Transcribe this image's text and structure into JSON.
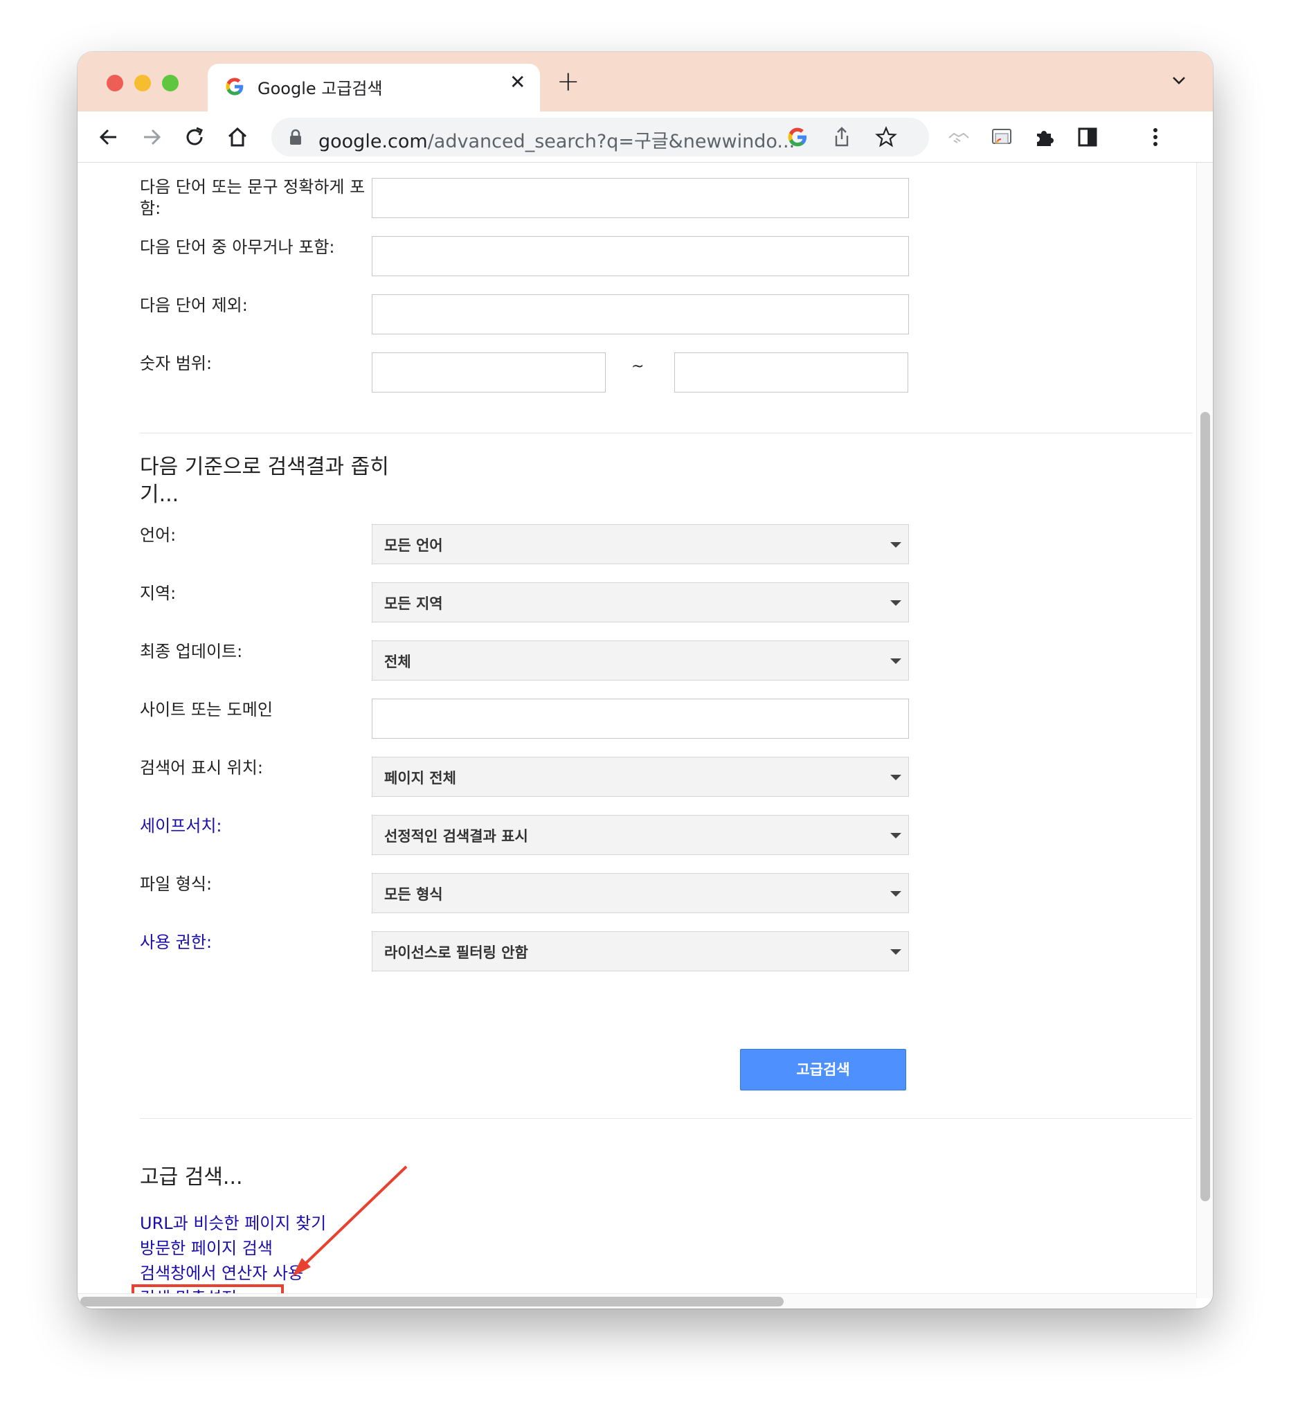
{
  "browser": {
    "tab_title": "Google 고급검색",
    "tab_close": "✕",
    "new_tab": "+",
    "url_host": "google.com",
    "url_path": "/advanced_search?q=구글&newwindo..."
  },
  "form_top": {
    "exact_phrase_label": "다음 단어 또는 문구 정확하게 포함:",
    "any_words_label": "다음 단어 중 아무거나 포함:",
    "exclude_label": "다음 단어 제외:",
    "range_label": "숫자 범위:",
    "range_separator": "~"
  },
  "narrow": {
    "title": "다음 기준으로 검색결과 좁히기...",
    "language_label": "언어:",
    "language_value": "모든 언어",
    "region_label": "지역:",
    "region_value": "모든 지역",
    "updated_label": "최종 업데이트:",
    "updated_value": "전체",
    "site_label": "사이트 또는 도메인",
    "terms_label": "검색어 표시 위치:",
    "terms_value": "페이지 전체",
    "safesearch_label": "세이프서치:",
    "safesearch_value": "선정적인 검색결과 표시",
    "filetype_label": "파일 형식:",
    "filetype_value": "모든 형식",
    "rights_label": "사용 권한:",
    "rights_value": "라이선스로 필터링 안함",
    "submit_label": "고급검색"
  },
  "footer": {
    "title": "고급 검색...",
    "links": [
      "URL과 비슷한 페이지 찾기",
      "방문한 페이지 검색",
      "검색창에서 연산자 사용",
      "검색 맞춤설정"
    ]
  },
  "colors": {
    "titlebar": "#f7dccd",
    "link": "#1a0dab",
    "button": "#4d90fe",
    "annotation": "#e8412f"
  }
}
